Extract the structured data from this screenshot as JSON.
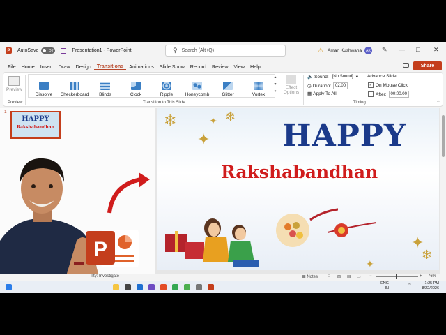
{
  "titlebar": {
    "autosave_label": "AutoSave",
    "autosave_state": "Off",
    "document_title": "Presentation1 - PowerPoint",
    "search_placeholder": "Search (Alt+Q)",
    "user_name": "Aman Kushwaha",
    "user_initials": "AK"
  },
  "menu": {
    "tabs": [
      "File",
      "Home",
      "Insert",
      "Draw",
      "Design",
      "Transitions",
      "Animations",
      "Slide Show",
      "Record",
      "Review",
      "View",
      "Help"
    ],
    "active_tab": "Transitions",
    "share_label": "Share"
  },
  "ribbon": {
    "preview_label": "Preview",
    "preview_group_label": "Preview",
    "transitions": [
      "Dissolve",
      "Checkerboard",
      "Blinds",
      "Clock",
      "Ripple",
      "Honeycomb",
      "Glitter",
      "Vortex"
    ],
    "effect_options_label": "Effect Options",
    "transition_group_label": "Transition to This Slide",
    "timing": {
      "sound_label": "Sound:",
      "sound_value": "[No Sound]",
      "duration_label": "Duration:",
      "duration_value": "02.00",
      "apply_all_label": "Apply To All",
      "advance_slide_label": "Advance Slide",
      "on_mouse_click_label": "On Mouse Click",
      "after_label": "After:",
      "after_value": "00:00.00",
      "group_label": "Timing"
    }
  },
  "slides_panel": {
    "slide_number": "1",
    "thumb_title": "HAPPY",
    "thumb_subtitle": "Rakshabandhan"
  },
  "slide": {
    "title": "HAPPY",
    "subtitle": "Rakshabandhan"
  },
  "statusbar": {
    "accessibility": "ility: Investigate",
    "notes_label": "Notes",
    "zoom": "76%"
  },
  "taskbar": {
    "language": "ENG",
    "region": "IN",
    "time": "1:25 PM",
    "date": "8/22/2026"
  },
  "colors": {
    "accent": "#c43e1c",
    "title_blue": "#1b3a8a",
    "subtitle_red": "#d01c1c"
  }
}
